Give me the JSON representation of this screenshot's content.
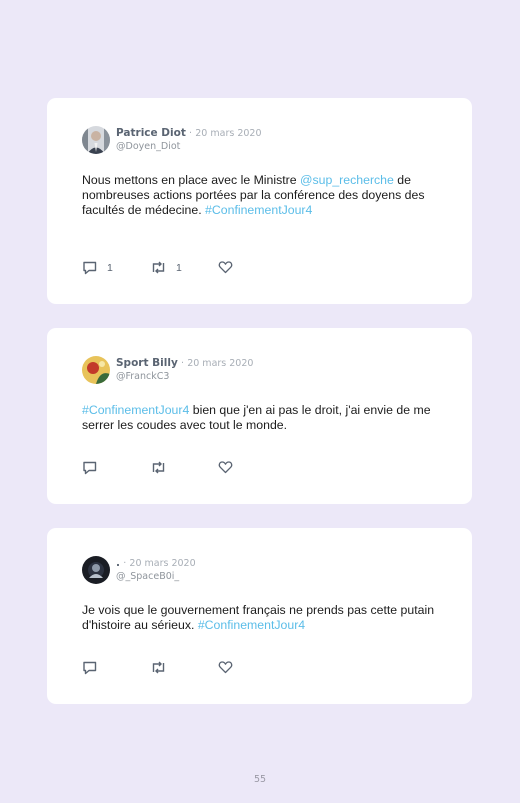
{
  "tweets": [
    {
      "name": "Patrice Diot",
      "date": "20 mars 2020",
      "handle": "@Doyen_Diot",
      "text": [
        "Nous mettons en place avec le Ministre ",
        "@sup_recherche",
        " de nombreuses actions portées par la conférence des doyens des facultés de médecine. ",
        "#ConfinementJour4"
      ],
      "reply_count": "1",
      "retweet_count": "1",
      "like_count": ""
    },
    {
      "name": "Sport Billy",
      "date": "20 mars 2020",
      "handle": "@FranckC3",
      "text": [
        "#ConfinementJour4",
        " bien que j'en ai pas le droit, j'ai envie de me serrer les coudes avec tout le monde."
      ],
      "reply_count": "",
      "retweet_count": "",
      "like_count": ""
    },
    {
      "name": ".",
      "date": "20 mars 2020",
      "handle": "@_SpaceB0i_",
      "text": [
        "Je vois que le gouvernement français ne prends pas cette putain d'histoire au sérieux. ",
        "#ConfinementJour4"
      ],
      "reply_count": "",
      "retweet_count": "",
      "like_count": ""
    }
  ],
  "separator": "·",
  "page_number": "55",
  "colors": {
    "background": "#ece8f8",
    "card": "#ffffff",
    "link": "#5bbde8",
    "name": "#5a6472",
    "muted": "#a8aeb6"
  }
}
